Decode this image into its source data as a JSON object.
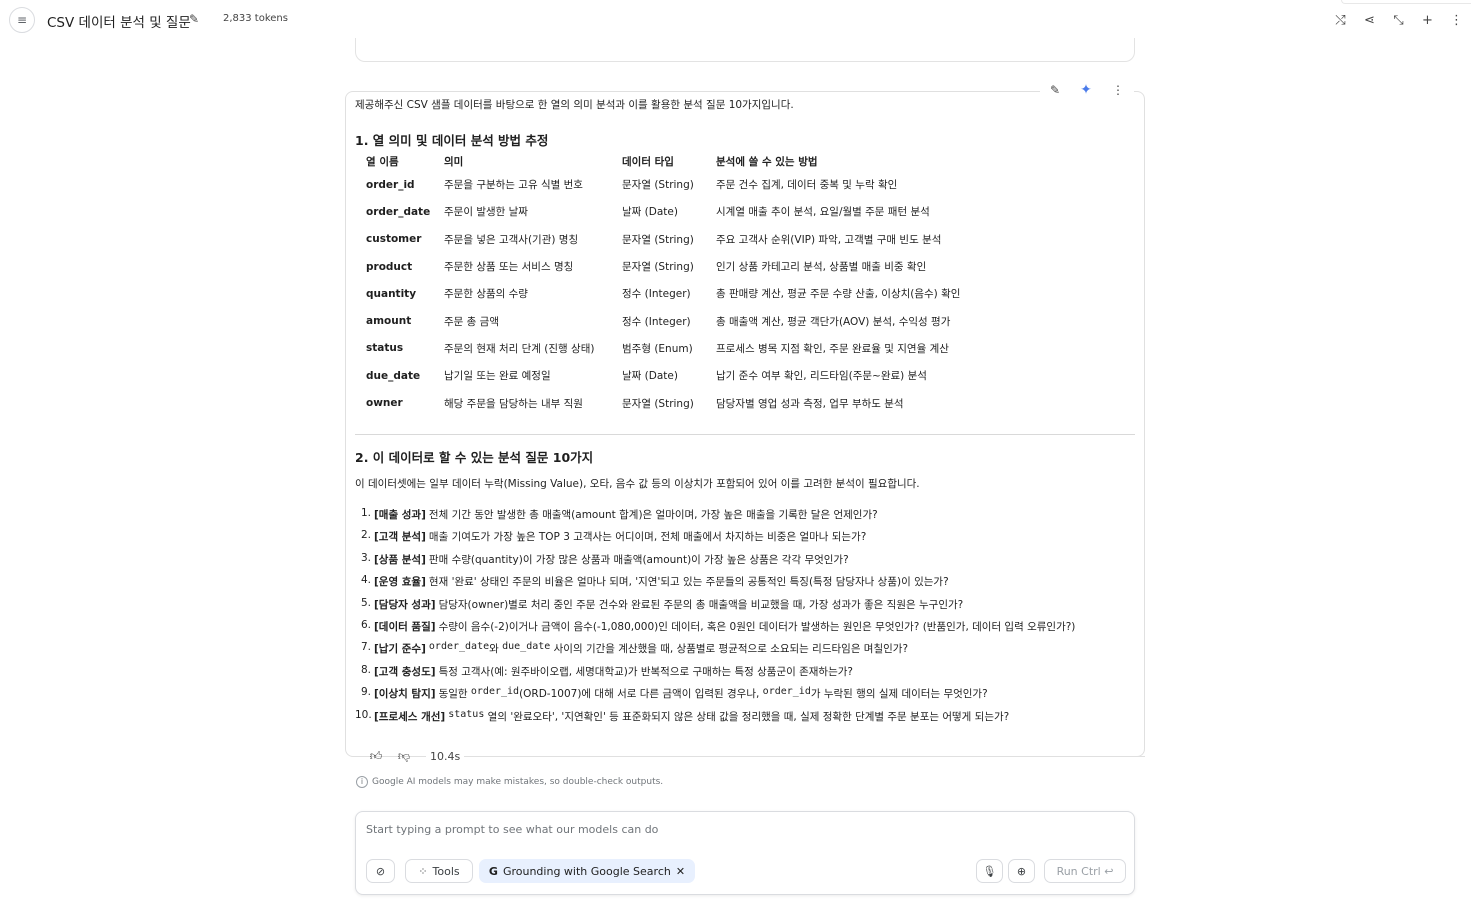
{
  "header": {
    "title": "CSV 데이터 분석 및 질문",
    "token_count": "2,833 tokens",
    "menu_icon": "menu-collapse-icon",
    "actions": [
      "compare-icon",
      "share-icon",
      "compress-icon",
      "add-icon",
      "more-vert-icon"
    ]
  },
  "response": {
    "intro": "제공해주신 CSV 샘플 데이터를 바탕으로 한 열의 의미 분석과 이를 활용한 분석 질문 10가지입니다.",
    "section1_title": "1. 열 의미 및 데이터 분석 방법 추정",
    "table": {
      "headers": [
        "열 이름",
        "의미",
        "데이터 타입",
        "분석에 쓸 수 있는 방법"
      ],
      "rows": [
        [
          "order_id",
          "주문을 구분하는 고유 식별 번호",
          "문자열 (String)",
          "주문 건수 집계, 데이터 중복 및 누락 확인"
        ],
        [
          "order_date",
          "주문이 발생한 날짜",
          "날짜 (Date)",
          "시계열 매출 추이 분석, 요일/월별 주문 패턴 분석"
        ],
        [
          "customer",
          "주문을 넣은 고객사(기관) 명칭",
          "문자열 (String)",
          "주요 고객사 순위(VIP) 파악, 고객별 구매 빈도 분석"
        ],
        [
          "product",
          "주문한 상품 또는 서비스 명칭",
          "문자열 (String)",
          "인기 상품 카테고리 분석, 상품별 매출 비중 확인"
        ],
        [
          "quantity",
          "주문한 상품의 수량",
          "정수 (Integer)",
          "총 판매량 계산, 평균 주문 수량 산출, 이상치(음수) 확인"
        ],
        [
          "amount",
          "주문 총 금액",
          "정수 (Integer)",
          "총 매출액 계산, 평균 객단가(AOV) 분석, 수익성 평가"
        ],
        [
          "status",
          "주문의 현재 처리 단계 (진행 상태)",
          "범주형 (Enum)",
          "프로세스 병목 지점 확인, 주문 완료율 및 지연율 계산"
        ],
        [
          "due_date",
          "납기일 또는 완료 예정일",
          "날짜 (Date)",
          "납기 준수 여부 확인, 리드타임(주문~완료) 분석"
        ],
        [
          "owner",
          "해당 주문을 담당하는 내부 직원",
          "문자열 (String)",
          "담당자별 영업 성과 측정, 업무 부하도 분석"
        ]
      ]
    },
    "section2_title": "2. 이 데이터로 할 수 있는 분석 질문 10가지",
    "section2_intro": "이 데이터셋에는 일부 데이터 누락(Missing Value), 오타, 음수 값 등의 이상치가 포함되어 있어 이를 고려한 분석이 필요합니다.",
    "questions": [
      {
        "num": "1.",
        "tag": "[매출 성과]",
        "parts": [
          {
            "t": "전체 기간 동안 발생한 총 매출액(amount 합계)은 얼마이며, 가장 높은 매출을 기록한 달은 언제인가?"
          }
        ]
      },
      {
        "num": "2.",
        "tag": "[고객 분석]",
        "parts": [
          {
            "t": "매출 기여도가 가장 높은 TOP 3 고객사는 어디이며, 전체 매출에서 차지하는 비중은 얼마나 되는가?"
          }
        ]
      },
      {
        "num": "3.",
        "tag": "[상품 분석]",
        "parts": [
          {
            "t": "판매 수량(quantity)이 가장 많은 상품과 매출액(amount)이 가장 높은 상품은 각각 무엇인가?"
          }
        ]
      },
      {
        "num": "4.",
        "tag": "[운영 효율]",
        "parts": [
          {
            "t": "현재 '완료' 상태인 주문의 비율은 얼마나 되며, '지연'되고 있는 주문들의 공통적인 특징(특정 담당자나 상품)이 있는가?"
          }
        ]
      },
      {
        "num": "5.",
        "tag": "[담당자 성과]",
        "parts": [
          {
            "t": "담당자(owner)별로 처리 중인 주문 건수와 완료된 주문의 총 매출액을 비교했을 때, 가장 성과가 좋은 직원은 누구인가?"
          }
        ]
      },
      {
        "num": "6.",
        "tag": "[데이터 품질]",
        "parts": [
          {
            "t": "수량이 음수(-2)이거나 금액이 음수(-1,080,000)인 데이터, 혹은 0원인 데이터가 발생하는 원인은 무엇인가? (반품인가, 데이터 입력 오류인가?)"
          }
        ]
      },
      {
        "num": "7.",
        "tag": "[납기 준수]",
        "parts": [
          {
            "c": "order_date"
          },
          {
            "t": "와 "
          },
          {
            "c": "due_date"
          },
          {
            "t": " 사이의 기간을 계산했을 때, 상품별로 평균적으로 소요되는 리드타임은 며칠인가?"
          }
        ]
      },
      {
        "num": "8.",
        "tag": "[고객 충성도]",
        "parts": [
          {
            "t": "특정 고객사(예: 원주바이오랩, 세명대학교)가 반복적으로 구매하는 특정 상품군이 존재하는가?"
          }
        ]
      },
      {
        "num": "9.",
        "tag": "[이상치 탐지]",
        "parts": [
          {
            "t": "동일한 "
          },
          {
            "c": "order_id"
          },
          {
            "t": "(ORD-1007)에 대해 서로 다른 금액이 입력된 경우나, "
          },
          {
            "c": "order_id"
          },
          {
            "t": "가 누락된 행의 실제 데이터는 무엇인가?"
          }
        ]
      },
      {
        "num": "10.",
        "tag": "[프로세스 개선]",
        "parts": [
          {
            "c": "status"
          },
          {
            "t": " 열의 '완료오타', '지연확인' 등 표준화되지 않은 상태 값을 정리했을 때, 실제 정확한 단계별 주문 분포는 어떻게 되는가?"
          }
        ]
      }
    ],
    "elapsed": "10.4s"
  },
  "disclaimer": "Google AI models may make mistakes, so double-check outputs.",
  "composer": {
    "placeholder": "Start typing a prompt to see what our models can do",
    "tools_label": "Tools",
    "grounding_label": "Grounding with Google Search",
    "run_label": "Run Ctrl ↩"
  }
}
